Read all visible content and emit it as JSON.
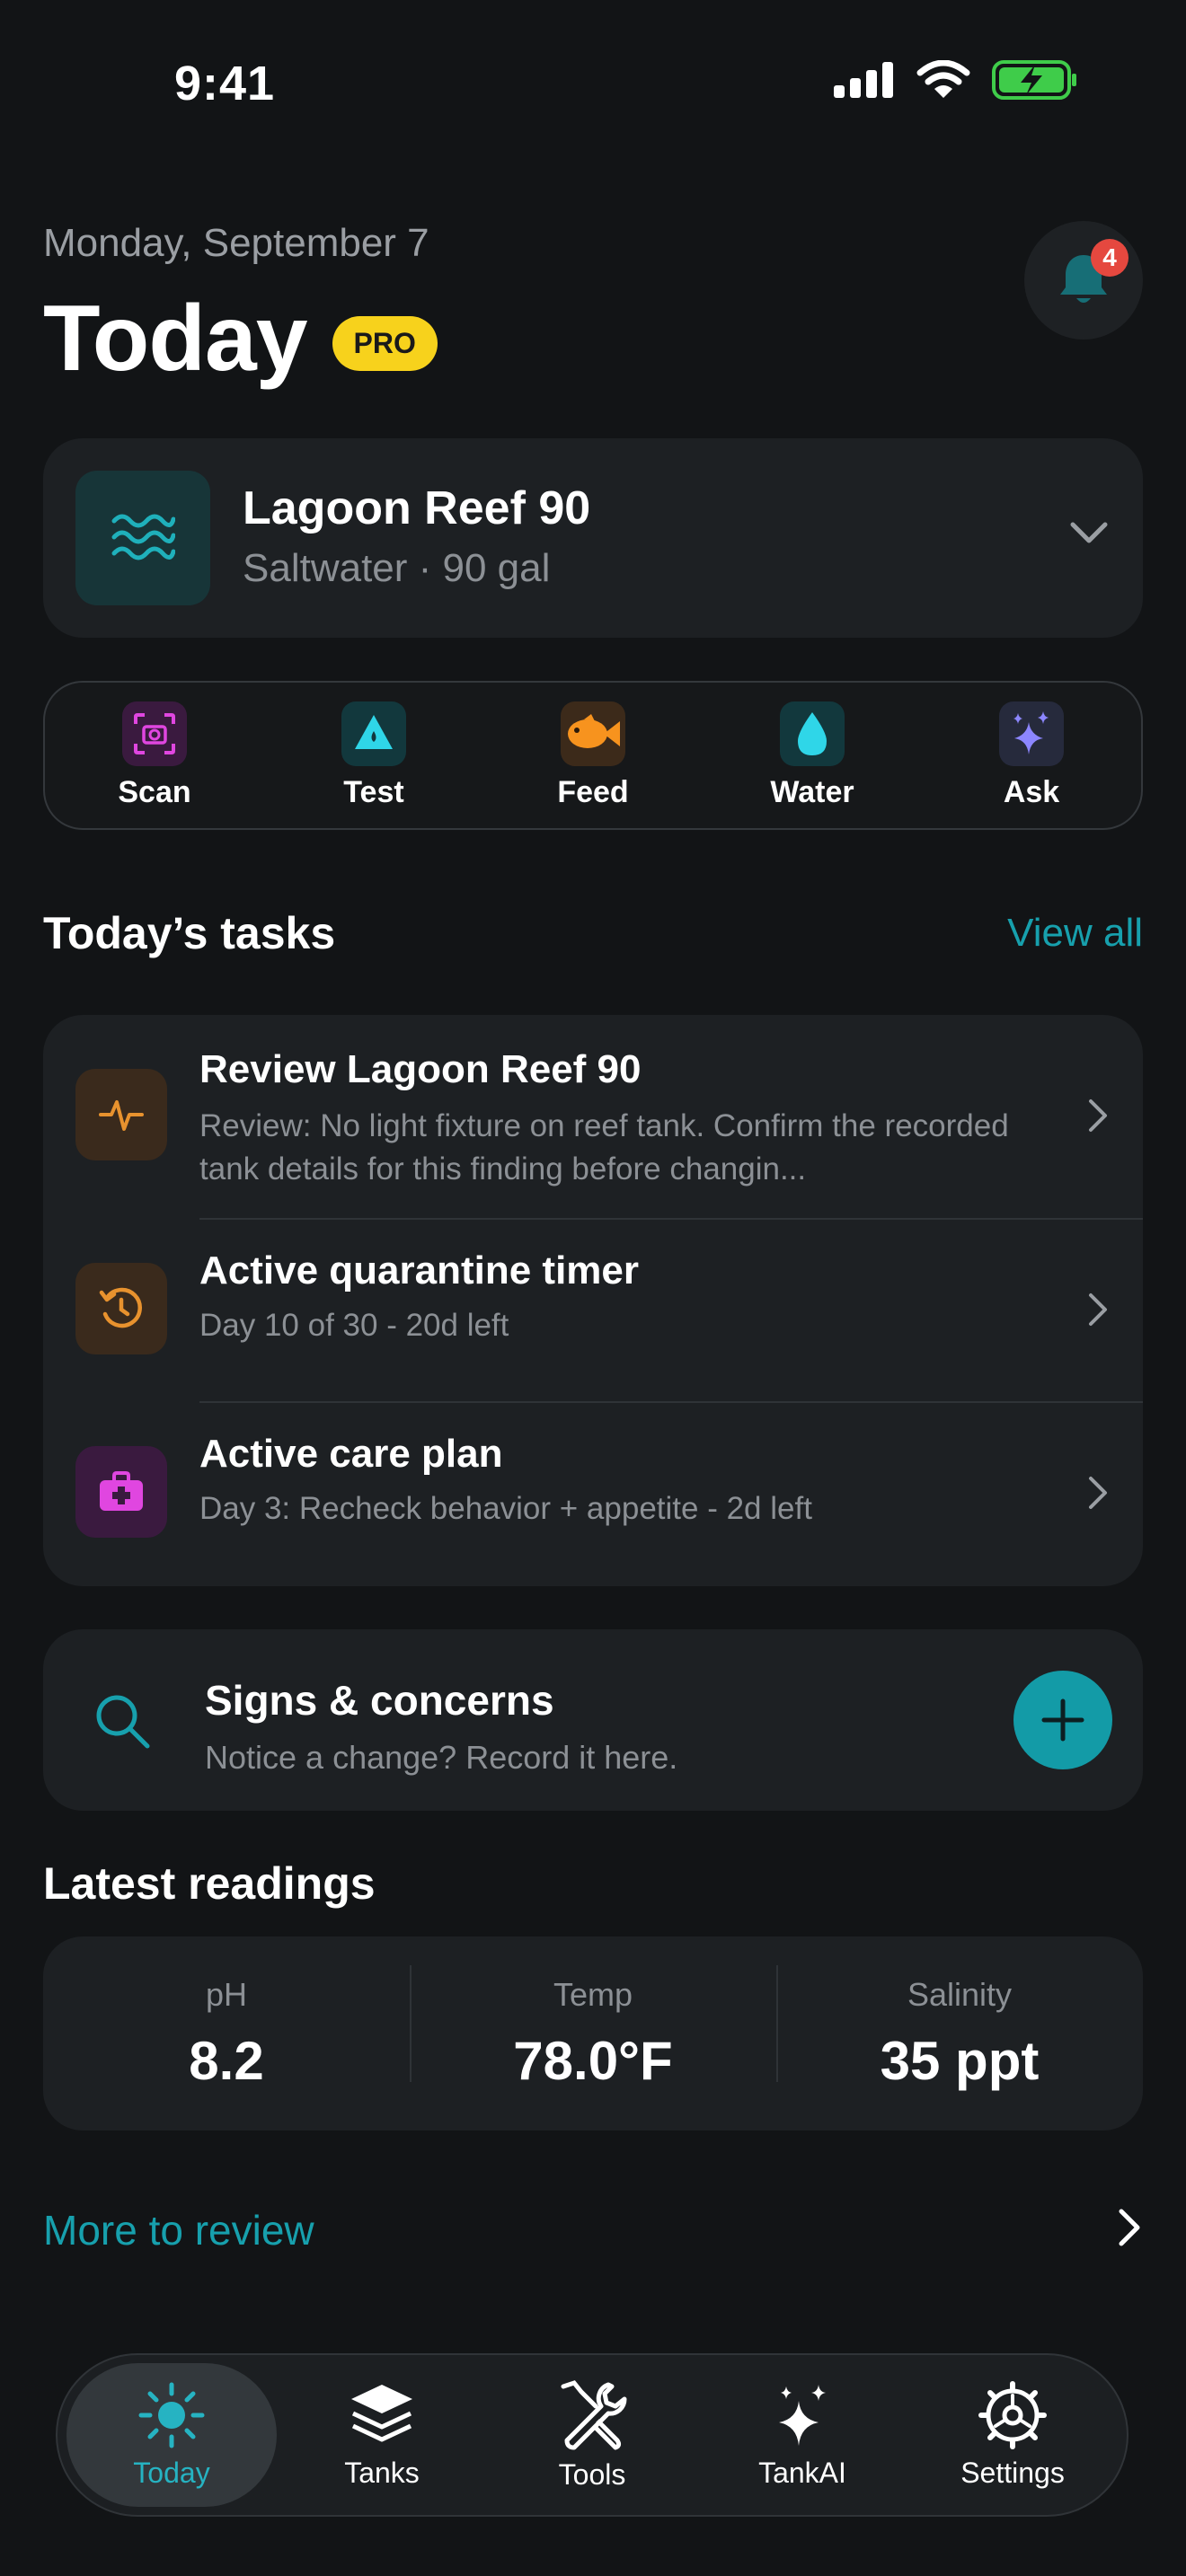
{
  "status_bar": {
    "time": "9:41"
  },
  "header": {
    "date": "Monday, September 7",
    "title": "Today",
    "badge": "PRO",
    "notifications_count": "4"
  },
  "tank": {
    "name": "Lagoon Reef 90",
    "subtitle": "Saltwater · 90 gal"
  },
  "quick_actions": [
    {
      "label": "Scan",
      "icon": "scan-camera-icon",
      "color": "#e046e0"
    },
    {
      "label": "Test",
      "icon": "test-drop-icon",
      "color": "#2fd6e8"
    },
    {
      "label": "Feed",
      "icon": "fish-icon",
      "color": "#f7931e"
    },
    {
      "label": "Water",
      "icon": "water-drop-icon",
      "color": "#2fd6e8"
    },
    {
      "label": "Ask",
      "icon": "sparkles-icon",
      "color": "#8c86ff"
    }
  ],
  "tasks_section": {
    "title": "Today’s tasks",
    "view_all": "View all"
  },
  "tasks": [
    {
      "title": "Review Lagoon Reef 90",
      "subtitle": "Review: No light fixture on reef tank. Confirm the recorded tank details for this finding before changin...",
      "icon": "pulse-icon",
      "color": "#e8922e"
    },
    {
      "title": "Active quarantine timer",
      "subtitle": "Day 10 of 30 - 20d left",
      "icon": "history-clock-icon",
      "color": "#e8922e"
    },
    {
      "title": "Active care plan",
      "subtitle": "Day 3: Recheck behavior + appetite - 2d left",
      "icon": "medical-kit-icon",
      "color": "#e046e0"
    }
  ],
  "signs": {
    "title": "Signs & concerns",
    "subtitle": "Notice a change? Record it here."
  },
  "readings_section": {
    "title": "Latest readings"
  },
  "readings": [
    {
      "label": "pH",
      "value": "8.2"
    },
    {
      "label": "Temp",
      "value": "78.0°F"
    },
    {
      "label": "Salinity",
      "value": "35 ppt"
    }
  ],
  "more_to_review": "More to review",
  "tabs": [
    {
      "label": "Today",
      "icon": "sun-icon",
      "active": true
    },
    {
      "label": "Tanks",
      "icon": "layers-icon",
      "active": false
    },
    {
      "label": "Tools",
      "icon": "tools-icon",
      "active": false
    },
    {
      "label": "TankAI",
      "icon": "sparkles-icon",
      "active": false
    },
    {
      "label": "Settings",
      "icon": "gear-icon",
      "active": false
    }
  ],
  "colors": {
    "accent": "#139ba7",
    "pro": "#f7d21c",
    "badge": "#e5483f"
  }
}
